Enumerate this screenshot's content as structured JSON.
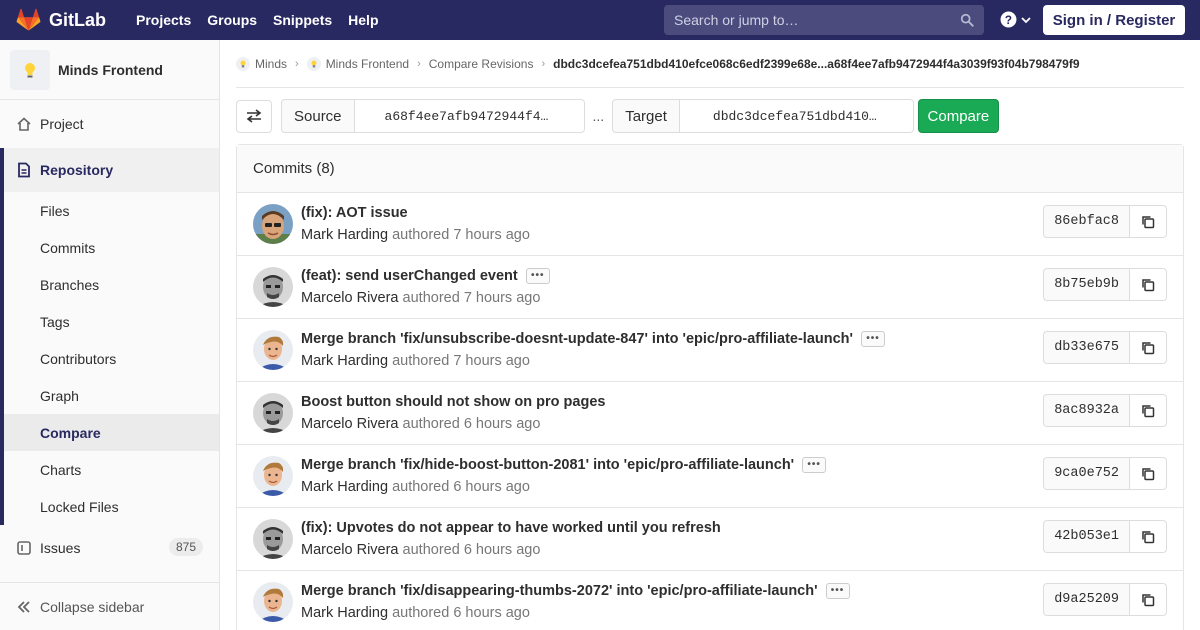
{
  "topbar": {
    "brand": "GitLab",
    "nav": [
      "Projects",
      "Groups",
      "Snippets",
      "Help"
    ],
    "search_placeholder": "Search or jump to…",
    "signin": "Sign in / Register"
  },
  "sidebar": {
    "project_name": "Minds Frontend",
    "project": "Project",
    "repository": "Repository",
    "repo_items": [
      "Files",
      "Commits",
      "Branches",
      "Tags",
      "Contributors",
      "Graph",
      "Compare",
      "Charts",
      "Locked Files"
    ],
    "active_item": "Compare",
    "issues": "Issues",
    "issues_count": "875",
    "collapse": "Collapse sidebar"
  },
  "breadcrumb": {
    "items": [
      "Minds",
      "Minds Frontend",
      "Compare Revisions"
    ],
    "current": "dbdc3dcefea751dbd410efce068c6edf2399e68e...a68f4ee7afb9472944f4a3039f93f04b798479f9"
  },
  "compare": {
    "source_label": "Source",
    "source_value": "a68f4ee7afb9472944f4…",
    "ellipsis": "...",
    "target_label": "Target",
    "target_value": "dbdc3dcefea751dbd410…",
    "button": "Compare"
  },
  "commits": {
    "header": "Commits (8)",
    "authored_word": "authored",
    "items": [
      {
        "title": "(fix): AOT issue",
        "author": "Mark Harding",
        "time": "7 hours ago",
        "sha": "86ebfac8",
        "more": false,
        "avatar": "mark"
      },
      {
        "title": "(feat): send userChanged event",
        "author": "Marcelo Rivera",
        "time": "7 hours ago",
        "sha": "8b75eb9b",
        "more": true,
        "avatar": "marcelo"
      },
      {
        "title": "Merge branch 'fix/unsubscribe-doesnt-update-847' into 'epic/pro-affiliate-launch'",
        "author": "Mark Harding",
        "time": "7 hours ago",
        "sha": "db33e675",
        "more": true,
        "avatar": "mark2"
      },
      {
        "title": "Boost button should not show on pro pages",
        "author": "Marcelo Rivera",
        "time": "6 hours ago",
        "sha": "8ac8932a",
        "more": false,
        "avatar": "marcelo"
      },
      {
        "title": "Merge branch 'fix/hide-boost-button-2081' into 'epic/pro-affiliate-launch'",
        "author": "Mark Harding",
        "time": "6 hours ago",
        "sha": "9ca0e752",
        "more": true,
        "avatar": "mark2"
      },
      {
        "title": "(fix): Upvotes do not appear to have worked until you refresh",
        "author": "Marcelo Rivera",
        "time": "6 hours ago",
        "sha": "42b053e1",
        "more": false,
        "avatar": "marcelo"
      },
      {
        "title": "Merge branch 'fix/disappearing-thumbs-2072' into 'epic/pro-affiliate-launch'",
        "author": "Mark Harding",
        "time": "6 hours ago",
        "sha": "d9a25209",
        "more": true,
        "avatar": "mark2"
      }
    ]
  }
}
